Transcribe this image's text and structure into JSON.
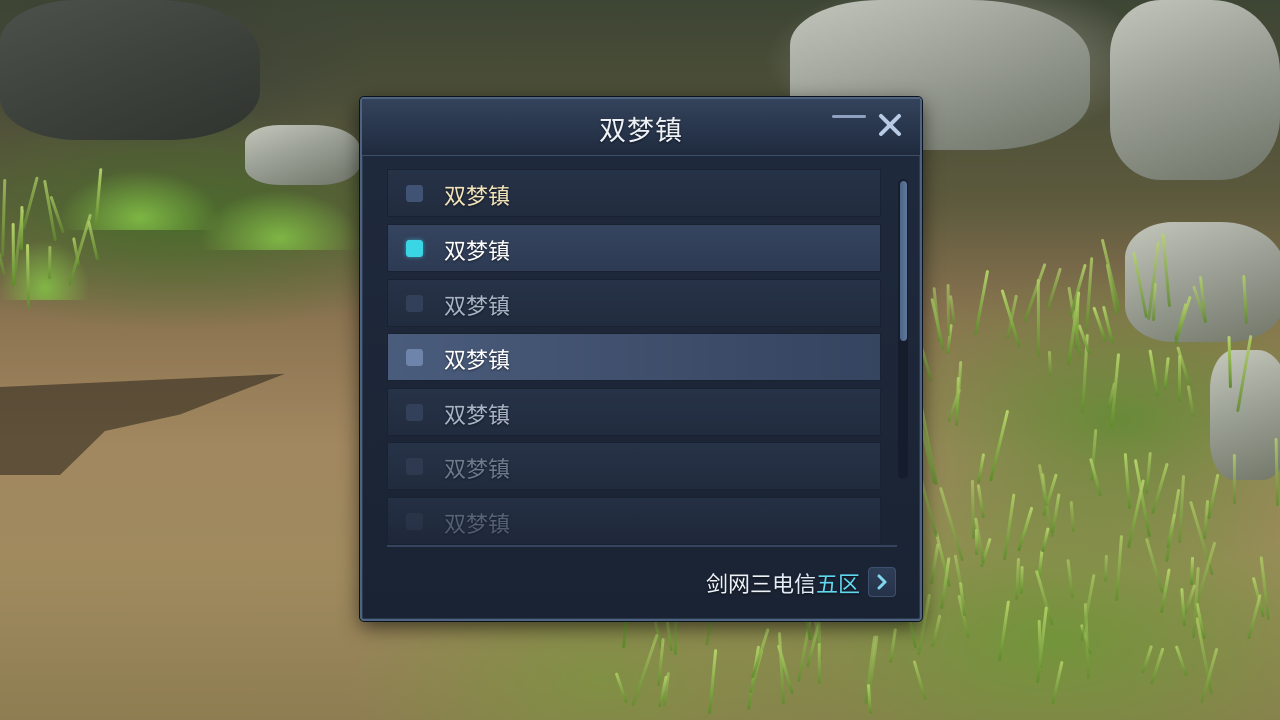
{
  "dialog": {
    "title": "双梦镇",
    "minimize_icon": "minimize-icon",
    "close_icon": "close-icon"
  },
  "list": {
    "items": [
      {
        "label": "双梦镇",
        "checkbox_color": "#415375",
        "text_color": "#f2e4b8",
        "state": "normal"
      },
      {
        "label": "双梦镇",
        "checkbox_color": "#3ad6e6",
        "text_color": "#ffffff",
        "state": "selected"
      },
      {
        "label": "双梦镇",
        "checkbox_color": "#33405a",
        "text_color": "#a8b4c6",
        "state": "normal"
      },
      {
        "label": "双梦镇",
        "checkbox_color": "#6f84aa",
        "text_color": "#ffffff",
        "state": "hover"
      },
      {
        "label": "双梦镇",
        "checkbox_color": "#33405a",
        "text_color": "#a8b4c6",
        "state": "normal"
      },
      {
        "label": "双梦镇",
        "checkbox_color": "#2f3a50",
        "text_color": "#6e7b8f",
        "state": "disabled"
      },
      {
        "label": "双梦镇",
        "checkbox_color": "#2f3a50",
        "text_color": "#6e7b8f",
        "state": "disabled"
      }
    ]
  },
  "footer": {
    "server_prefix": "剑网三",
    "server_mid": "电信",
    "server_suffix": "五区",
    "arrow_icon": "chevron-right-icon"
  },
  "colors": {
    "accent_cyan": "#3ad6e6",
    "panel_bg": "#1f2a3d",
    "panel_border": "#4e6380"
  }
}
